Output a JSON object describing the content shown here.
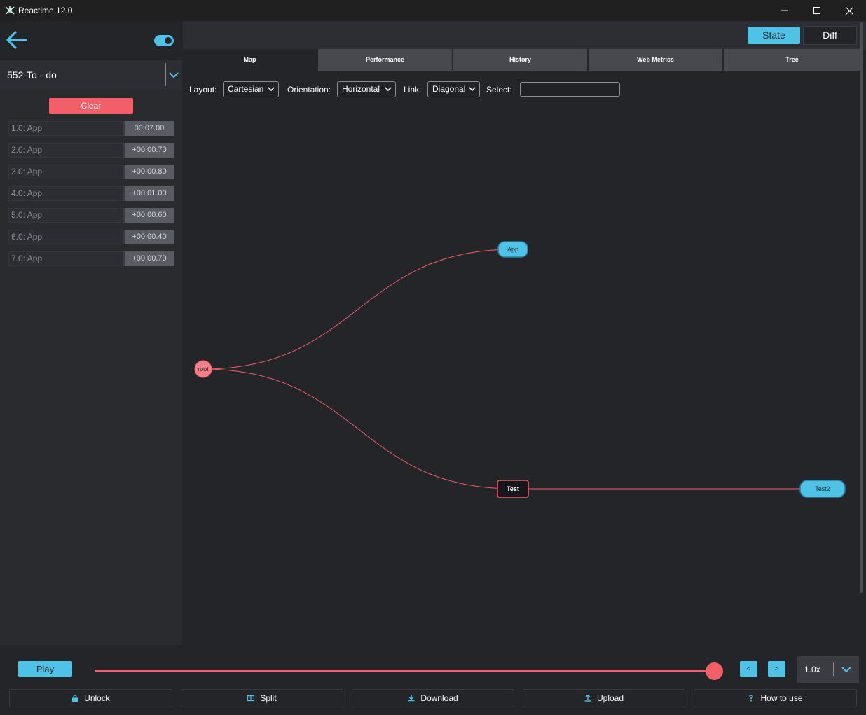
{
  "window": {
    "title": "Reactime 12.0"
  },
  "sidebar": {
    "tab_selected": "552-To - do",
    "clear_label": "Clear",
    "snapshots": [
      {
        "label": "1.0:  App",
        "time": "00:07.00"
      },
      {
        "label": "2.0:  App",
        "time": "+00:00.70"
      },
      {
        "label": "3.0:  App",
        "time": "+00:00.80"
      },
      {
        "label": "4.0:  App",
        "time": "+00:01.00"
      },
      {
        "label": "5.0:  App",
        "time": "+00:00.60"
      },
      {
        "label": "6.0:  App",
        "time": "+00:00.40"
      },
      {
        "label": "7.0:  App",
        "time": "+00:00.70"
      }
    ]
  },
  "main": {
    "state_label": "State",
    "diff_label": "Diff",
    "tabs": [
      {
        "label": "Map",
        "active": true
      },
      {
        "label": "Performance",
        "active": false
      },
      {
        "label": "History",
        "active": false
      },
      {
        "label": "Web Metrics",
        "active": false
      },
      {
        "label": "Tree",
        "active": false
      }
    ],
    "toolbar": {
      "layout_label": "Layout:",
      "layout_value": "Cartesian",
      "orientation_label": "Orientation:",
      "orientation_value": "Horizontal",
      "link_label": "Link:",
      "link_value": "Diagonal",
      "select_label": "Select:",
      "select_value": ""
    },
    "tree": {
      "nodes": [
        {
          "id": "root",
          "label": "root",
          "kind": "root"
        },
        {
          "id": "app",
          "label": "App",
          "kind": "leaf"
        },
        {
          "id": "test",
          "label": "Test",
          "kind": "parent"
        },
        {
          "id": "test2",
          "label": "Test2",
          "kind": "leaf"
        }
      ],
      "links": [
        {
          "from": "root",
          "to": "app"
        },
        {
          "from": "root",
          "to": "test"
        },
        {
          "from": "test",
          "to": "test2"
        }
      ]
    }
  },
  "bottom": {
    "play_label": "Play",
    "slider_value_fraction": 1.0,
    "prev_label": "<",
    "next_label": ">",
    "speed_value": "1.0x",
    "actions": [
      {
        "label": "Unlock",
        "icon": "lock-icon"
      },
      {
        "label": "Split",
        "icon": "split-icon"
      },
      {
        "label": "Download",
        "icon": "download-icon"
      },
      {
        "label": "Upload",
        "icon": "upload-icon"
      },
      {
        "label": "How to use",
        "icon": "question-icon"
      }
    ]
  },
  "colors": {
    "accent": "#4fc3e7",
    "danger": "#f25f69",
    "background": "#242529",
    "panel": "#2a2b2f"
  }
}
